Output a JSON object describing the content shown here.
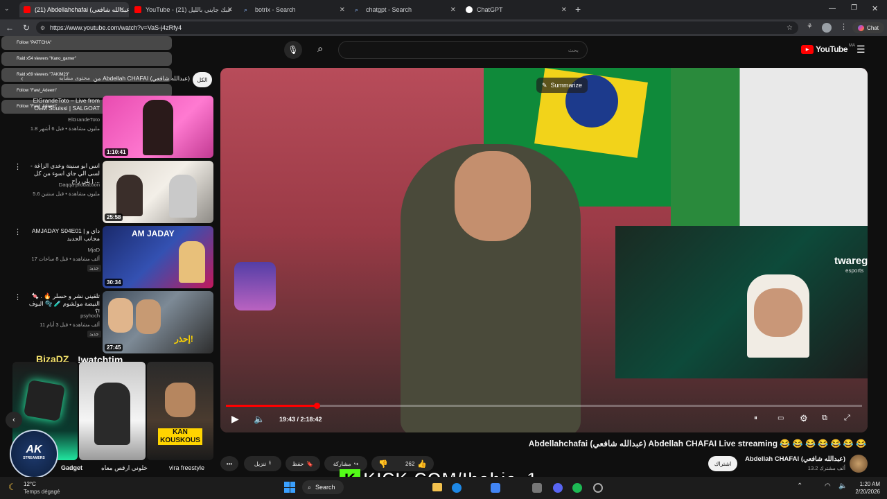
{
  "browser": {
    "tabs": [
      {
        "title": "(21) Abdellahchafai (عبدالله شافعي)",
        "active": true
      },
      {
        "title": "YouTube - (21) حبك جايني بالليل",
        "active": false
      },
      {
        "title": "botrix - Search",
        "active": false
      },
      {
        "title": "chatgpt - Search",
        "active": false
      },
      {
        "title": "ChatGPT",
        "active": false
      }
    ],
    "new_tab": "+",
    "url": "https://www.youtube.com/watch?v=VaS-j4zRfy4",
    "chat_label": "Chat"
  },
  "youtube": {
    "logo_text": "YouTube",
    "logo_region": "MA",
    "search_placeholder": "بحث"
  },
  "overlay": {
    "follow_rows": [
      "Follow \"PATTCHA\"",
      "Raid x54 viewers \"Kano_gamer\"",
      "Raid x69 viewers \"7AKIM23\"",
      "Follow \"Fawl_Adeem\"",
      "Follow \"Fawl_Adeem\""
    ],
    "kick_text": "KICK.COM/Ibahja_1",
    "bizadz": "BizaDZ",
    "watchtime": "!watchtim",
    "twareg_text": "twareg",
    "twareg_sub": "esports"
  },
  "filters": {
    "all": "الكل",
    "from": "من Abdellah CHAFAI (عبدالله شافعي)",
    "related": "محتوى مشابه"
  },
  "recs": [
    {
      "title": "ElGrandeToto – Live from OLM Souissi | SALGOAT",
      "channel": "ElGrandeToto",
      "meta": "1.8 مليون مشاهدة • قبل 6 أشهر",
      "duration": "1:10:41"
    },
    {
      "title": "انس ابو سنينة وعدي الزاغة - لسى الي جاي اسوء من كل يلي راح | ...",
      "channel": "Daqqa prodaction",
      "meta": "5.6 مليون مشاهدة • قبل سنتين",
      "duration": "25:58"
    },
    {
      "title": "AMJADAY S04E01 | داي و مجانب الجديد",
      "channel": "MjaD",
      "meta": "17 ألف مشاهدة • قبل 8 ساعات",
      "badge": "جديد",
      "duration": "30:34",
      "thumb_text": "AM JADAY"
    },
    {
      "title": "تلقيني نشر و حسلر 🔥 . 🍬 النيضة مولشوم 🧪 🫧 البوف !؟",
      "channel": "psyhoch",
      "meta": "11 ألف مشاهدة • قبل 3 أيام",
      "badge": "جديد",
      "duration": "27:45",
      "thumb_text": "إحذر!"
    }
  ],
  "shorts": [
    {
      "title": "Gadget"
    },
    {
      "title": "خلوني ارقص معاه"
    },
    {
      "title": "vira freestyle",
      "thumb_text": "KAN KOUSKOUS"
    }
  ],
  "ak_logo": {
    "line1": "AK",
    "line2": "STREAMERS"
  },
  "player": {
    "summarize": "Summarize",
    "time": "19:43 / 2:18:42",
    "progress": 0.1422
  },
  "video": {
    "title": "Abdellahchafai (عبدالله شافعي) Abdellah CHAFAI Live streaming 😂 😂 😂 😂 😂 😂 😂",
    "channel": "Abdellah CHAFAI (عبدالله شافعي)",
    "subs": "13.2 ألف مشترك",
    "subscribe": "اشتراك",
    "likes": "262",
    "share": "مشاركة",
    "save": "حفظ",
    "download": "تنزيل",
    "more": "•••"
  },
  "taskbar": {
    "weather_temp": "12°C",
    "weather_desc": "Temps dégagé",
    "search": "Search",
    "time": "1:20 AM",
    "date": "2/20/2026"
  },
  "colors": {
    "accent": "#ff0000",
    "kick": "#53fc18",
    "bg": "#0f0f0f"
  }
}
